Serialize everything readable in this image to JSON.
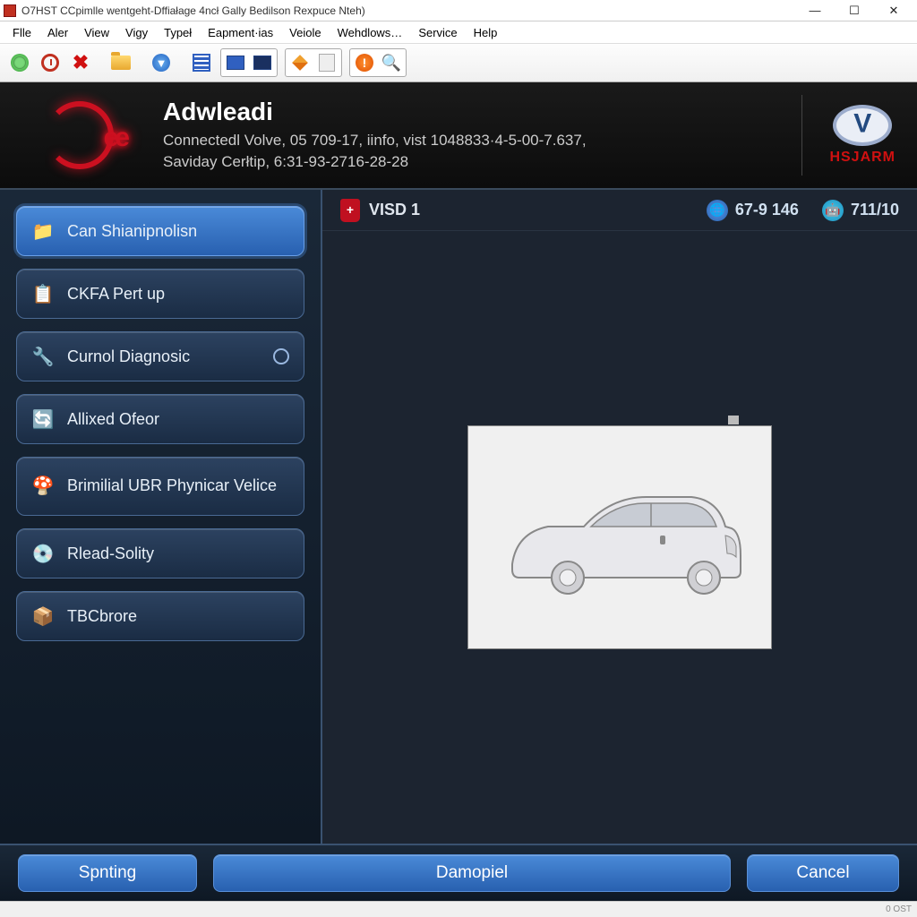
{
  "title": "O7HST CCpimlle wentgeht-Dffiałage 4ncł Gally Bedilson Rexpuce Nteh)",
  "menu": [
    "Flle",
    "Aler",
    "View",
    "Vigy",
    "Typeł",
    "Eapment·ias",
    "Veiole",
    "Wehdlows…",
    "Service",
    "Help"
  ],
  "header": {
    "title": "Adwleadi",
    "line1": "Connectedl Volve, 05 709-17, iinfo, vist 1048833·4-5-00-7.637,",
    "line2": "Saviday Cerłtip, 6:31-93-2716-28-28",
    "brand": "HSJARM"
  },
  "sidebar": [
    {
      "icon": "📁",
      "label": "Can Shianipnolisn",
      "active": true
    },
    {
      "icon": "📋",
      "label": "CKFA Pert up"
    },
    {
      "icon": "🔧",
      "label": "Curnol Diagnosic",
      "radio": true
    },
    {
      "icon": "🔄",
      "label": "Allixed Ofeor"
    },
    {
      "icon": "🍄",
      "label": "Brimilial UBR Phynicar Velice",
      "tall": true
    },
    {
      "icon": "💿",
      "label": "Rlead-Solity"
    },
    {
      "icon": "📦",
      "label": "TBCbrore"
    }
  ],
  "mainhdr": {
    "title": "VISD 1",
    "stat1": "67-9 146",
    "stat2": "711/10"
  },
  "footer": {
    "b1": "Spnting",
    "b2": "Damopiel",
    "b3": "Cancel"
  },
  "status": {
    "left": "",
    "right": "0 OST"
  }
}
